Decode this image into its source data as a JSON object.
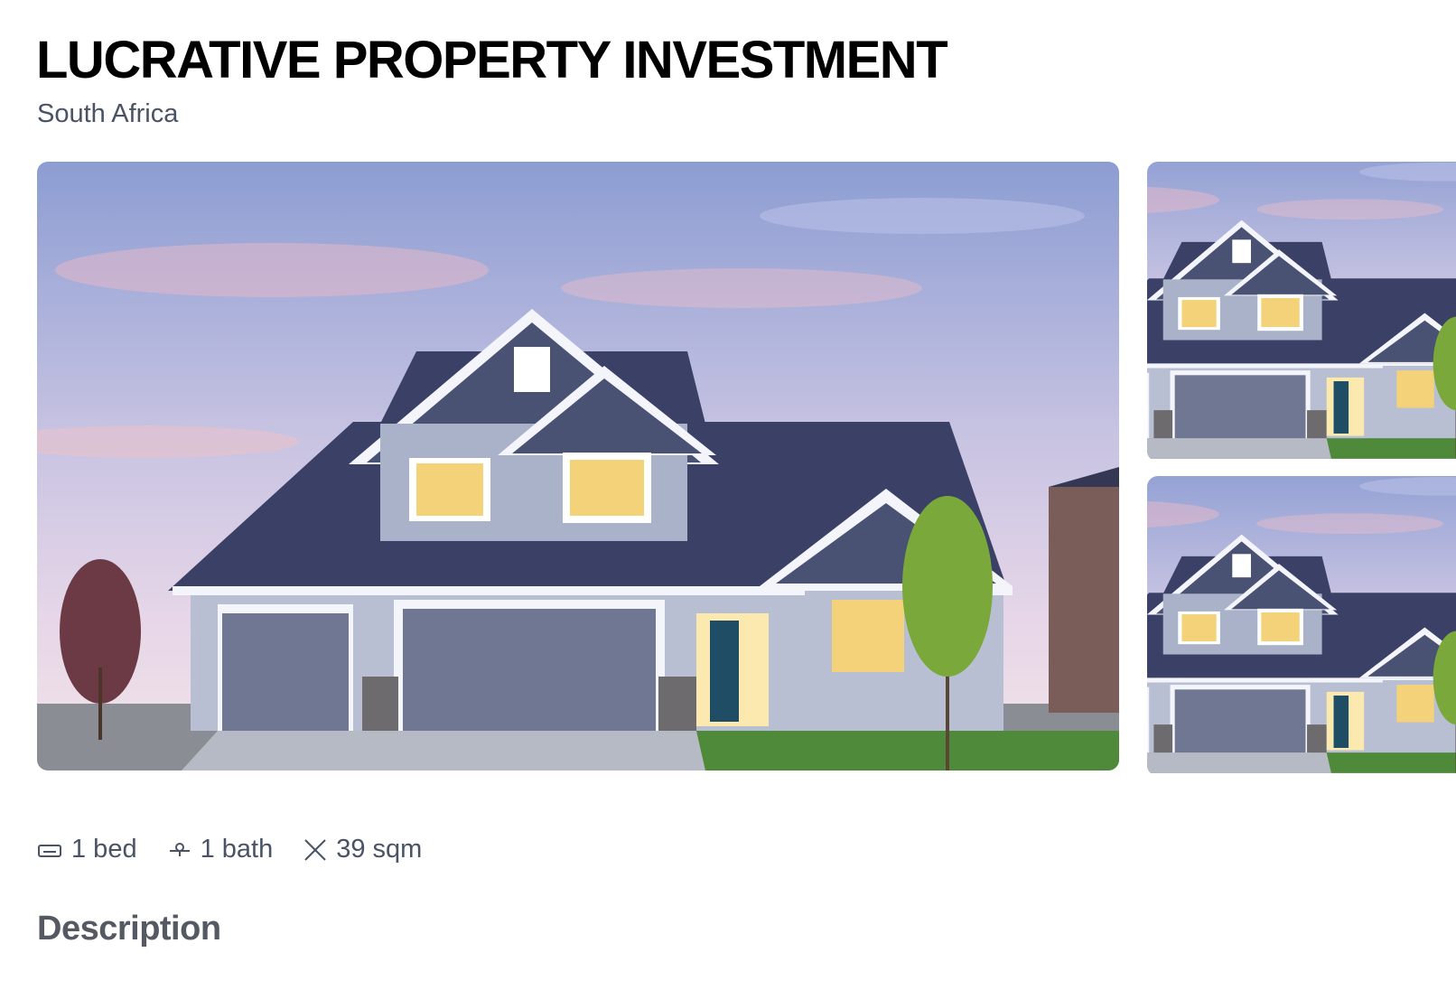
{
  "listing": {
    "title": "LUCRATIVE PROPERTY INVESTMENT",
    "location": "South Africa"
  },
  "gallery": {
    "main_image": "house-exterior-dusk-photo",
    "thumbnails": [
      "house-exterior-dusk-photo",
      "house-exterior-dusk-photo"
    ]
  },
  "features": {
    "beds": {
      "icon": "bed-icon",
      "label": "1 bed"
    },
    "baths": {
      "icon": "shower-icon",
      "label": "1 bath"
    },
    "area": {
      "icon": "area-icon",
      "label": "39 sqm"
    }
  },
  "sections": {
    "description_heading": "Description"
  },
  "colors": {
    "text_primary": "#000000",
    "text_secondary": "#4a5364",
    "heading_gray": "#555a62",
    "sky_top": "#8e9fd4",
    "sky_pink": "#e9b7c8",
    "roof": "#3b4166",
    "siding": "#a9b2c8",
    "window_glow": "#f4d27a"
  }
}
